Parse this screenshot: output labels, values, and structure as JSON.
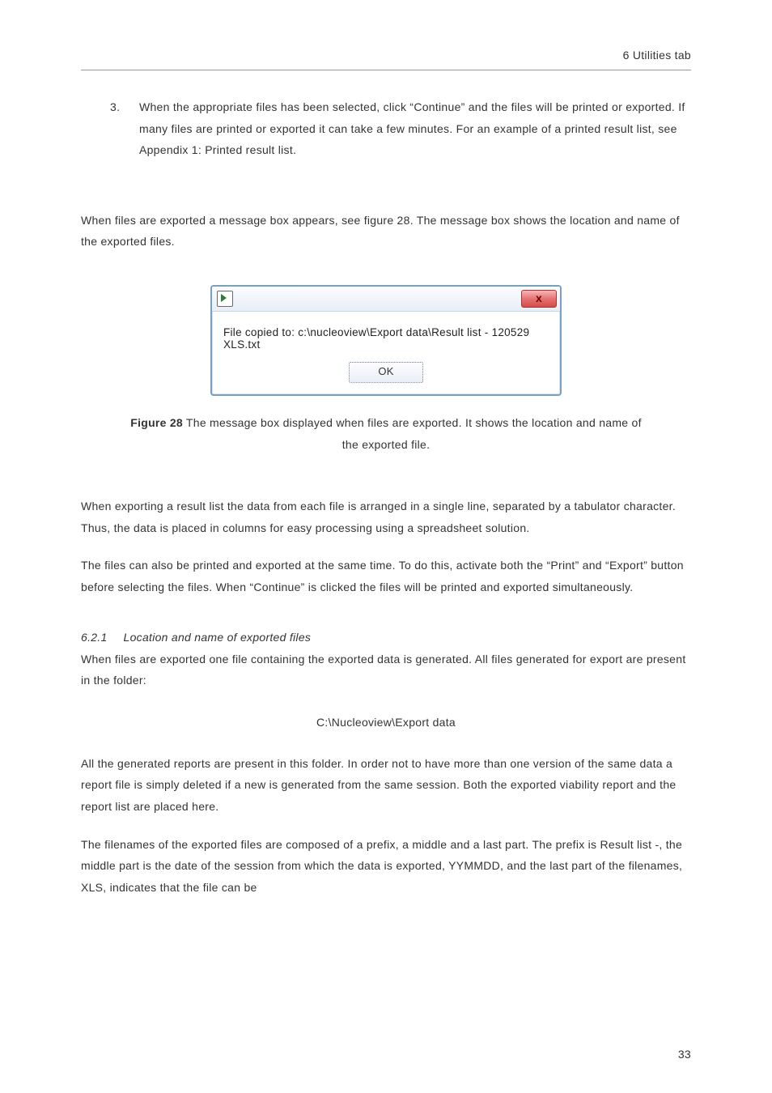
{
  "header": {
    "right": "6 Utilities tab"
  },
  "list": {
    "num": "3.",
    "text": "When the appropriate files has been selected, click “Continue” and the files will be printed or exported. If many files are printed or exported it can take a few minutes. For an example of a printed result list, see Appendix 1: Printed result list."
  },
  "p1": "When files are exported a message box appears, see figure 28. The message box shows the location and name of the exported files.",
  "dialog": {
    "close_glyph": "x",
    "message": "File copied to: c:\\nucleoview\\Export data\\Result list - 120529 XLS.txt",
    "ok": "OK"
  },
  "caption": {
    "label": "Figure 28",
    "rest": " The message box displayed when files are exported. It shows the location and name of the exported file."
  },
  "p2": "When exporting a result list the data from each file is arranged in a single line, separated by a tabulator character. Thus, the data is placed in columns for easy processing using a spreadsheet solution.",
  "p3": "The files can also be printed and exported at the same time. To do this, activate both the “Print” and “Export” button before selecting the files. When “Continue” is clicked the files will be printed and exported simultaneously.",
  "sub": {
    "num": "6.2.1",
    "title": "Location and name of exported files"
  },
  "p4": "When files are exported one file containing the exported data is generated. All files generated for export are present in the folder:",
  "path": "C:\\Nucleoview\\Export data",
  "p5": "All the generated reports are present in this folder. In order not to have more than one version of the same data a report file is simply deleted if a new is generated from the same session. Both the exported viability report and the report list are placed here.",
  "p6": "The filenames of the exported files are composed of a prefix, a middle and a last part. The prefix is Result list -, the middle part is the date of the session from which the data is exported, YYMMDD, and the last part of the filenames, XLS, indicates that the file can be",
  "page_number": "33"
}
